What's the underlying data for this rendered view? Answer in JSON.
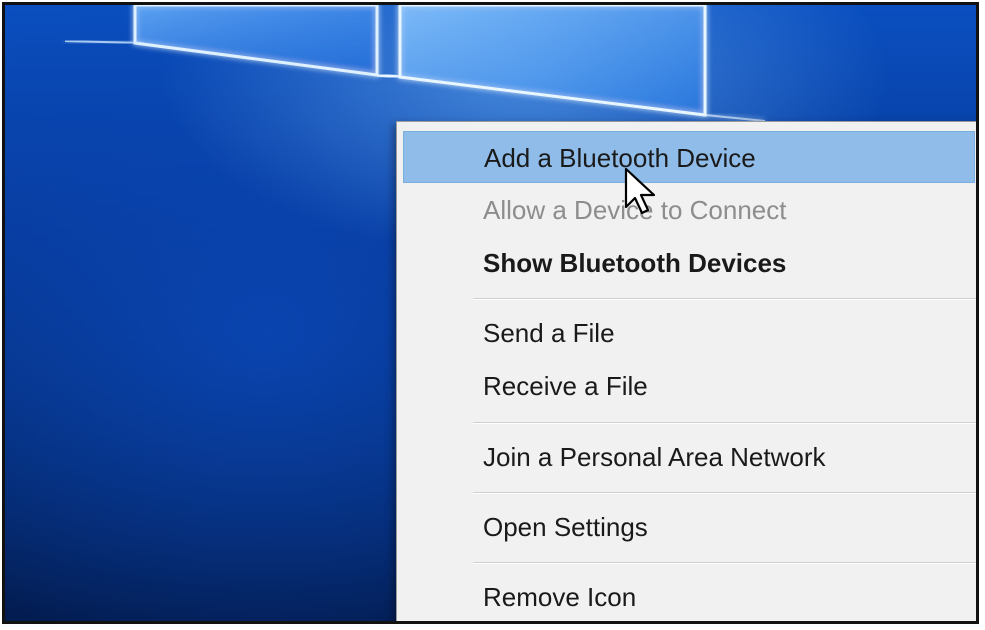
{
  "context_menu": {
    "items": [
      {
        "label": "Add a Bluetooth Device",
        "state": "highlighted"
      },
      {
        "label": "Allow a Device to Connect",
        "state": "disabled"
      },
      {
        "label": "Show Bluetooth Devices",
        "state": "default-bold"
      },
      {
        "label": "Send a File",
        "state": "normal"
      },
      {
        "label": "Receive a File",
        "state": "normal"
      },
      {
        "label": "Join a Personal Area Network",
        "state": "normal"
      },
      {
        "label": "Open Settings",
        "state": "normal"
      },
      {
        "label": "Remove Icon",
        "state": "normal"
      }
    ],
    "highlight_color": "#8fbce9",
    "background_color": "#f1f1f1"
  },
  "desktop": {
    "wallpaper": "windows-10-hero-blue",
    "accent_color": "#0a4fc0"
  },
  "pointer": {
    "icon": "arrow-cursor-icon"
  }
}
